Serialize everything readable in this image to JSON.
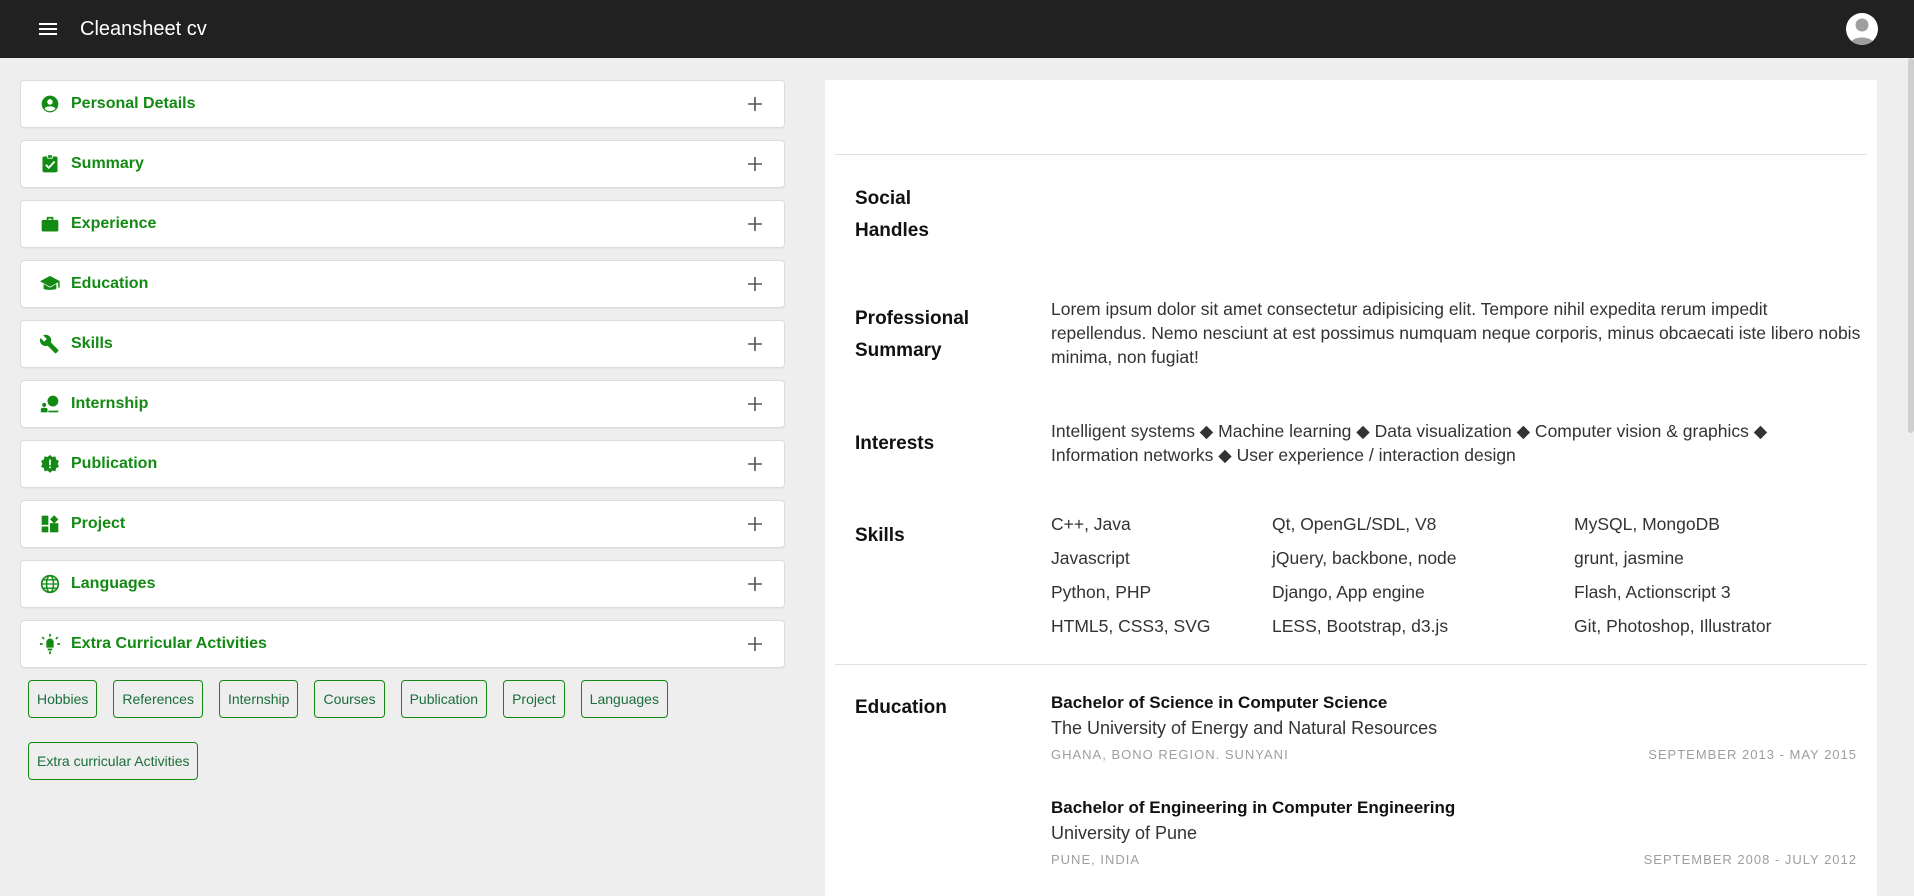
{
  "app": {
    "title": "Cleansheet cv"
  },
  "sections": [
    {
      "label": "Personal Details",
      "icon": "account-circle-icon"
    },
    {
      "label": "Summary",
      "icon": "assignment-check-icon"
    },
    {
      "label": "Experience",
      "icon": "work-briefcase-icon"
    },
    {
      "label": "Education",
      "icon": "school-icon"
    },
    {
      "label": "Skills",
      "icon": "wrench-icon"
    },
    {
      "label": "Internship",
      "icon": "person-board-icon"
    },
    {
      "label": "Publication",
      "icon": "new-releases-icon"
    },
    {
      "label": "Project",
      "icon": "dashboard-icon"
    },
    {
      "label": "Languages",
      "icon": "globe-icon"
    },
    {
      "label": "Extra Curricular Activities",
      "icon": "lightbulb-icon"
    }
  ],
  "chips": [
    "Hobbies",
    "References",
    "Internship",
    "Courses",
    "Publication",
    "Project",
    "Languages",
    "Extra curricular Activities"
  ],
  "cv": {
    "social_title_1": "Social",
    "social_title_2": "Handles",
    "summary_title_1": "Professional",
    "summary_title_2": "Summary",
    "summary_text": "Lorem ipsum dolor sit amet consectetur adipisicing elit. Tempore nihil expedita rerum impedit repellendus. Nemo nesciunt at est possimus numquam neque corporis, minus obcaecati iste libero nobis minima, non fugiat!",
    "interests_title": "Interests",
    "interests_line1": "Intelligent systems ◆ Machine learning ◆ Data visualization ◆ Computer vision & graphics ◆",
    "interests_line2": "Information networks ◆ User experience / interaction design",
    "skills_title": "Skills",
    "skills": [
      [
        "C++, Java",
        "Qt, OpenGL/SDL, V8",
        "MySQL, MongoDB"
      ],
      [
        "Javascript",
        "jQuery, backbone, node",
        "grunt, jasmine"
      ],
      [
        "Python, PHP",
        "Django, App engine",
        "Flash, Actionscript 3"
      ],
      [
        "HTML5, CSS3, SVG",
        "LESS, Bootstrap, d3.js",
        "Git, Photoshop, Illustrator"
      ]
    ],
    "education_title": "Education",
    "education": [
      {
        "degree": "Bachelor of Science in Computer Science",
        "school": "The University of Energy and Natural Resources",
        "location": "GHANA, BONO REGION. SUNYANI",
        "dates": "SEPTEMBER 2013 - MAY 2015"
      },
      {
        "degree": "Bachelor of Engineering in Computer Engineering",
        "school": "University of Pune",
        "location": "PUNE, INDIA",
        "dates": "SEPTEMBER 2008 - JULY 2012"
      }
    ]
  },
  "colors": {
    "accent": "#138a13",
    "topbar": "#212121",
    "background": "#eeeeee"
  }
}
